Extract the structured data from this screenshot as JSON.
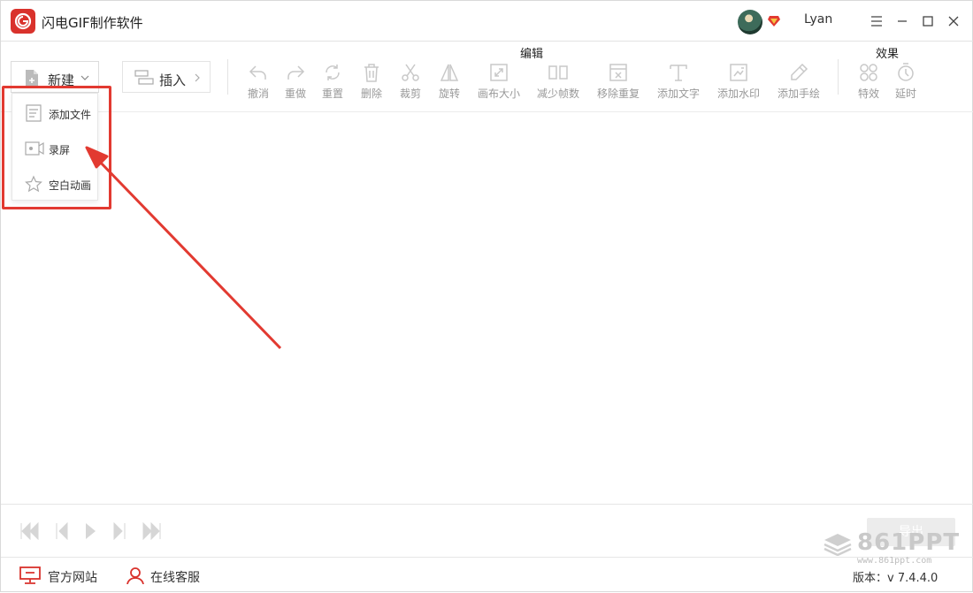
{
  "app": {
    "title": "闪电GIF制作软件"
  },
  "user": {
    "name": "Lyan"
  },
  "toolbar": {
    "new_label": "新建",
    "insert_label": "插入",
    "edit_group_label": "编辑",
    "effects_group_label": "效果",
    "edit_tools": [
      {
        "label": "撤消",
        "icon": "undo-icon"
      },
      {
        "label": "重做",
        "icon": "redo-icon"
      },
      {
        "label": "重置",
        "icon": "reset-icon"
      },
      {
        "label": "删除",
        "icon": "delete-icon"
      },
      {
        "label": "裁剪",
        "icon": "scissors-icon"
      },
      {
        "label": "旋转",
        "icon": "rotate-icon"
      },
      {
        "label": "画布大小",
        "icon": "canvas-size-icon"
      },
      {
        "label": "减少帧数",
        "icon": "reduce-frames-icon"
      },
      {
        "label": "移除重复",
        "icon": "remove-duplicates-icon"
      },
      {
        "label": "添加文字",
        "icon": "add-text-icon"
      },
      {
        "label": "添加水印",
        "icon": "add-watermark-icon"
      },
      {
        "label": "添加手绘",
        "icon": "pencil-icon"
      }
    ],
    "effect_tools": [
      {
        "label": "特效",
        "icon": "effects-icon"
      },
      {
        "label": "延时",
        "icon": "timer-icon"
      }
    ]
  },
  "new_menu": {
    "items": [
      {
        "label": "添加文件",
        "icon": "file-icon"
      },
      {
        "label": "录屏",
        "icon": "record-screen-icon"
      },
      {
        "label": "空白动画",
        "icon": "star-icon"
      }
    ]
  },
  "playback": {
    "export_label": "导出"
  },
  "statusbar": {
    "website_label": "官方网站",
    "support_label": "在线客服",
    "version_text": "版本：v 7.4.4.0"
  },
  "watermark": {
    "text": "861PPT",
    "url": "www.861ppt.com"
  },
  "colors": {
    "accent": "#d9322c",
    "highlight": "#e23a31",
    "disabled": "#c8c8c8"
  }
}
